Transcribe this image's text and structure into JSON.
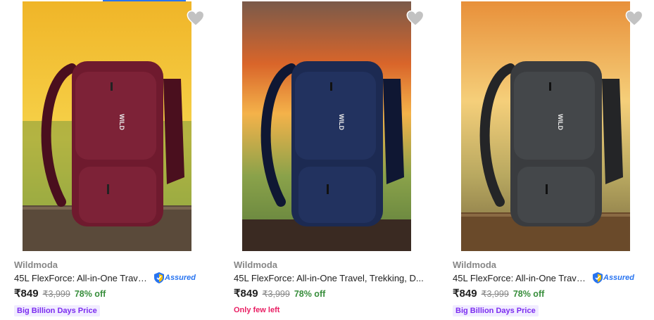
{
  "products": [
    {
      "brand": "Wildmoda",
      "title": "45L FlexForce: All-in-One Travel...",
      "assured": true,
      "assured_label": "Assured",
      "price": "₹849",
      "mrp": "₹3,999",
      "discount": "78% off",
      "tag": "Big Billion Days Price",
      "bag_color": "#6f1a2e",
      "bag_shadow": "#4a0f1e",
      "sky_top": "#f2c230",
      "sky_bottom": "#d9e35a"
    },
    {
      "brand": "Wildmoda",
      "title": "45L FlexForce: All-in-One Travel, Trekking, D...",
      "assured": false,
      "price": "₹849",
      "mrp": "₹3,999",
      "discount": "78% off",
      "alert": "Only few left",
      "bag_color": "#1c2a52",
      "bag_shadow": "#0f1733",
      "sky_top": "#d9652a",
      "sky_bottom": "#f2b84a"
    },
    {
      "brand": "Wildmoda",
      "title": "45L FlexForce: All-in-One Travel...",
      "assured": true,
      "assured_label": "Assured",
      "price": "₹849",
      "mrp": "₹3,999",
      "discount": "78% off",
      "tag": "Big Billion Days Price",
      "bag_color": "#3a3c3f",
      "bag_shadow": "#242527",
      "sky_top": "#e8a043",
      "sky_bottom": "#f5cf7a"
    }
  ],
  "icons": {
    "wishlist": "heart-icon",
    "assured": "assured-shield-icon"
  },
  "colors": {
    "accent": "#2874f0",
    "discount": "#388e3c",
    "tag_bg": "#f1ecff",
    "tag_fg": "#7b2cf0",
    "alert": "#e91e63"
  }
}
